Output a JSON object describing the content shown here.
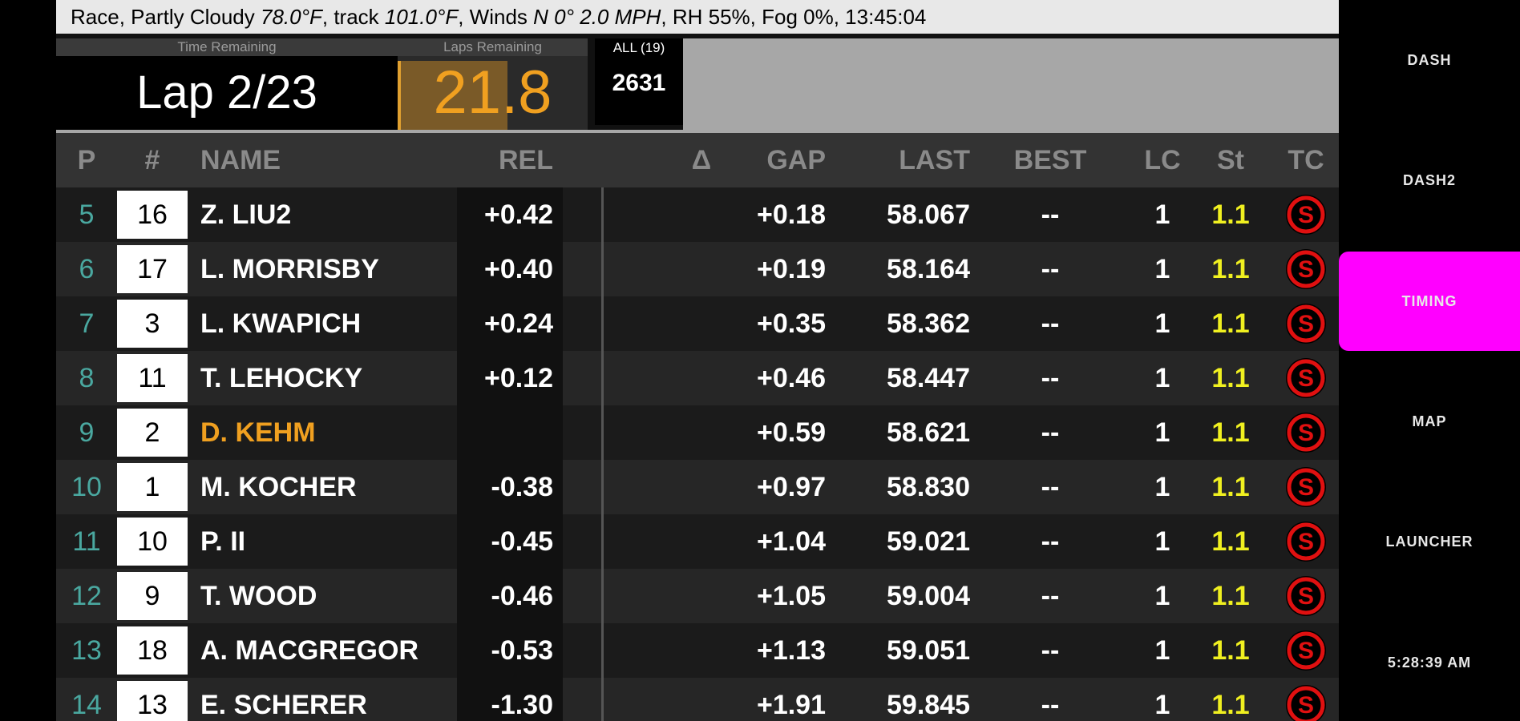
{
  "weather": {
    "prefix": "Race, Partly Cloudy ",
    "air": "78.0°F",
    "track_label": ", track ",
    "track": "101.0°F",
    "winds_label": ", Winds ",
    "winds": "N 0° 2.0 MPH",
    "rest": ", RH 55%, Fog 0%, 13:45:04"
  },
  "session": {
    "time_remaining_label": "Time Remaining",
    "laps_remaining_label": "Laps Remaining",
    "lap_text": "Lap 2/23",
    "laps_remaining_value": "21.8",
    "laps_remaining_fraction": 0.58,
    "filter_label": "ALL (19)",
    "filter_value": "2631"
  },
  "columns": {
    "p": "P",
    "num": "#",
    "name": "NAME",
    "rel": "REL",
    "delta": "Δ",
    "gap": "GAP",
    "last": "LAST",
    "best": "BEST",
    "lc": "LC",
    "st": "St",
    "tc": "TC"
  },
  "rows": [
    {
      "pos": "5",
      "num": "16",
      "name": "Z. LIU2",
      "rel": "+0.42",
      "gap": "+0.18",
      "last": "58.067",
      "best": "--",
      "lc": "1",
      "st": "1.1",
      "highlight": false
    },
    {
      "pos": "6",
      "num": "17",
      "name": "L. MORRISBY",
      "rel": "+0.40",
      "gap": "+0.19",
      "last": "58.164",
      "best": "--",
      "lc": "1",
      "st": "1.1",
      "highlight": false
    },
    {
      "pos": "7",
      "num": "3",
      "name": "L. KWAPICH",
      "rel": "+0.24",
      "gap": "+0.35",
      "last": "58.362",
      "best": "--",
      "lc": "1",
      "st": "1.1",
      "highlight": false
    },
    {
      "pos": "8",
      "num": "11",
      "name": "T. LEHOCKY",
      "rel": "+0.12",
      "gap": "+0.46",
      "last": "58.447",
      "best": "--",
      "lc": "1",
      "st": "1.1",
      "highlight": false
    },
    {
      "pos": "9",
      "num": "2",
      "name": "D. KEHM",
      "rel": "",
      "gap": "+0.59",
      "last": "58.621",
      "best": "--",
      "lc": "1",
      "st": "1.1",
      "highlight": true
    },
    {
      "pos": "10",
      "num": "1",
      "name": "M. KOCHER",
      "rel": "-0.38",
      "gap": "+0.97",
      "last": "58.830",
      "best": "--",
      "lc": "1",
      "st": "1.1",
      "highlight": false
    },
    {
      "pos": "11",
      "num": "10",
      "name": "P. II",
      "rel": "-0.45",
      "gap": "+1.04",
      "last": "59.021",
      "best": "--",
      "lc": "1",
      "st": "1.1",
      "highlight": false
    },
    {
      "pos": "12",
      "num": "9",
      "name": "T. WOOD",
      "rel": "-0.46",
      "gap": "+1.05",
      "last": "59.004",
      "best": "--",
      "lc": "1",
      "st": "1.1",
      "highlight": false
    },
    {
      "pos": "13",
      "num": "18",
      "name": "A. MACGREGOR",
      "rel": "-0.53",
      "gap": "+1.13",
      "last": "59.051",
      "best": "--",
      "lc": "1",
      "st": "1.1",
      "highlight": false
    },
    {
      "pos": "14",
      "num": "13",
      "name": "E. SCHERER",
      "rel": "-1.30",
      "gap": "+1.91",
      "last": "59.845",
      "best": "--",
      "lc": "1",
      "st": "1.1",
      "highlight": false
    }
  ],
  "tire_icon": {
    "name": "soft-tire-icon",
    "letter": "S",
    "color": "#e01010"
  },
  "nav": [
    {
      "id": "dash",
      "label": "DASH",
      "active": false
    },
    {
      "id": "dash2",
      "label": "DASH2",
      "active": false
    },
    {
      "id": "timing",
      "label": "TIMING",
      "active": true
    },
    {
      "id": "map",
      "label": "MAP",
      "active": false
    },
    {
      "id": "launcher",
      "label": "LAUNCHER",
      "active": false
    }
  ],
  "clock": "5:28:39 AM",
  "colors": {
    "accent": "#ff00ff",
    "position_text": "#4aa8a0",
    "highlight_name": "#f0a020",
    "stint_text": "#f0f020",
    "laps_remaining": "#f0a020"
  }
}
